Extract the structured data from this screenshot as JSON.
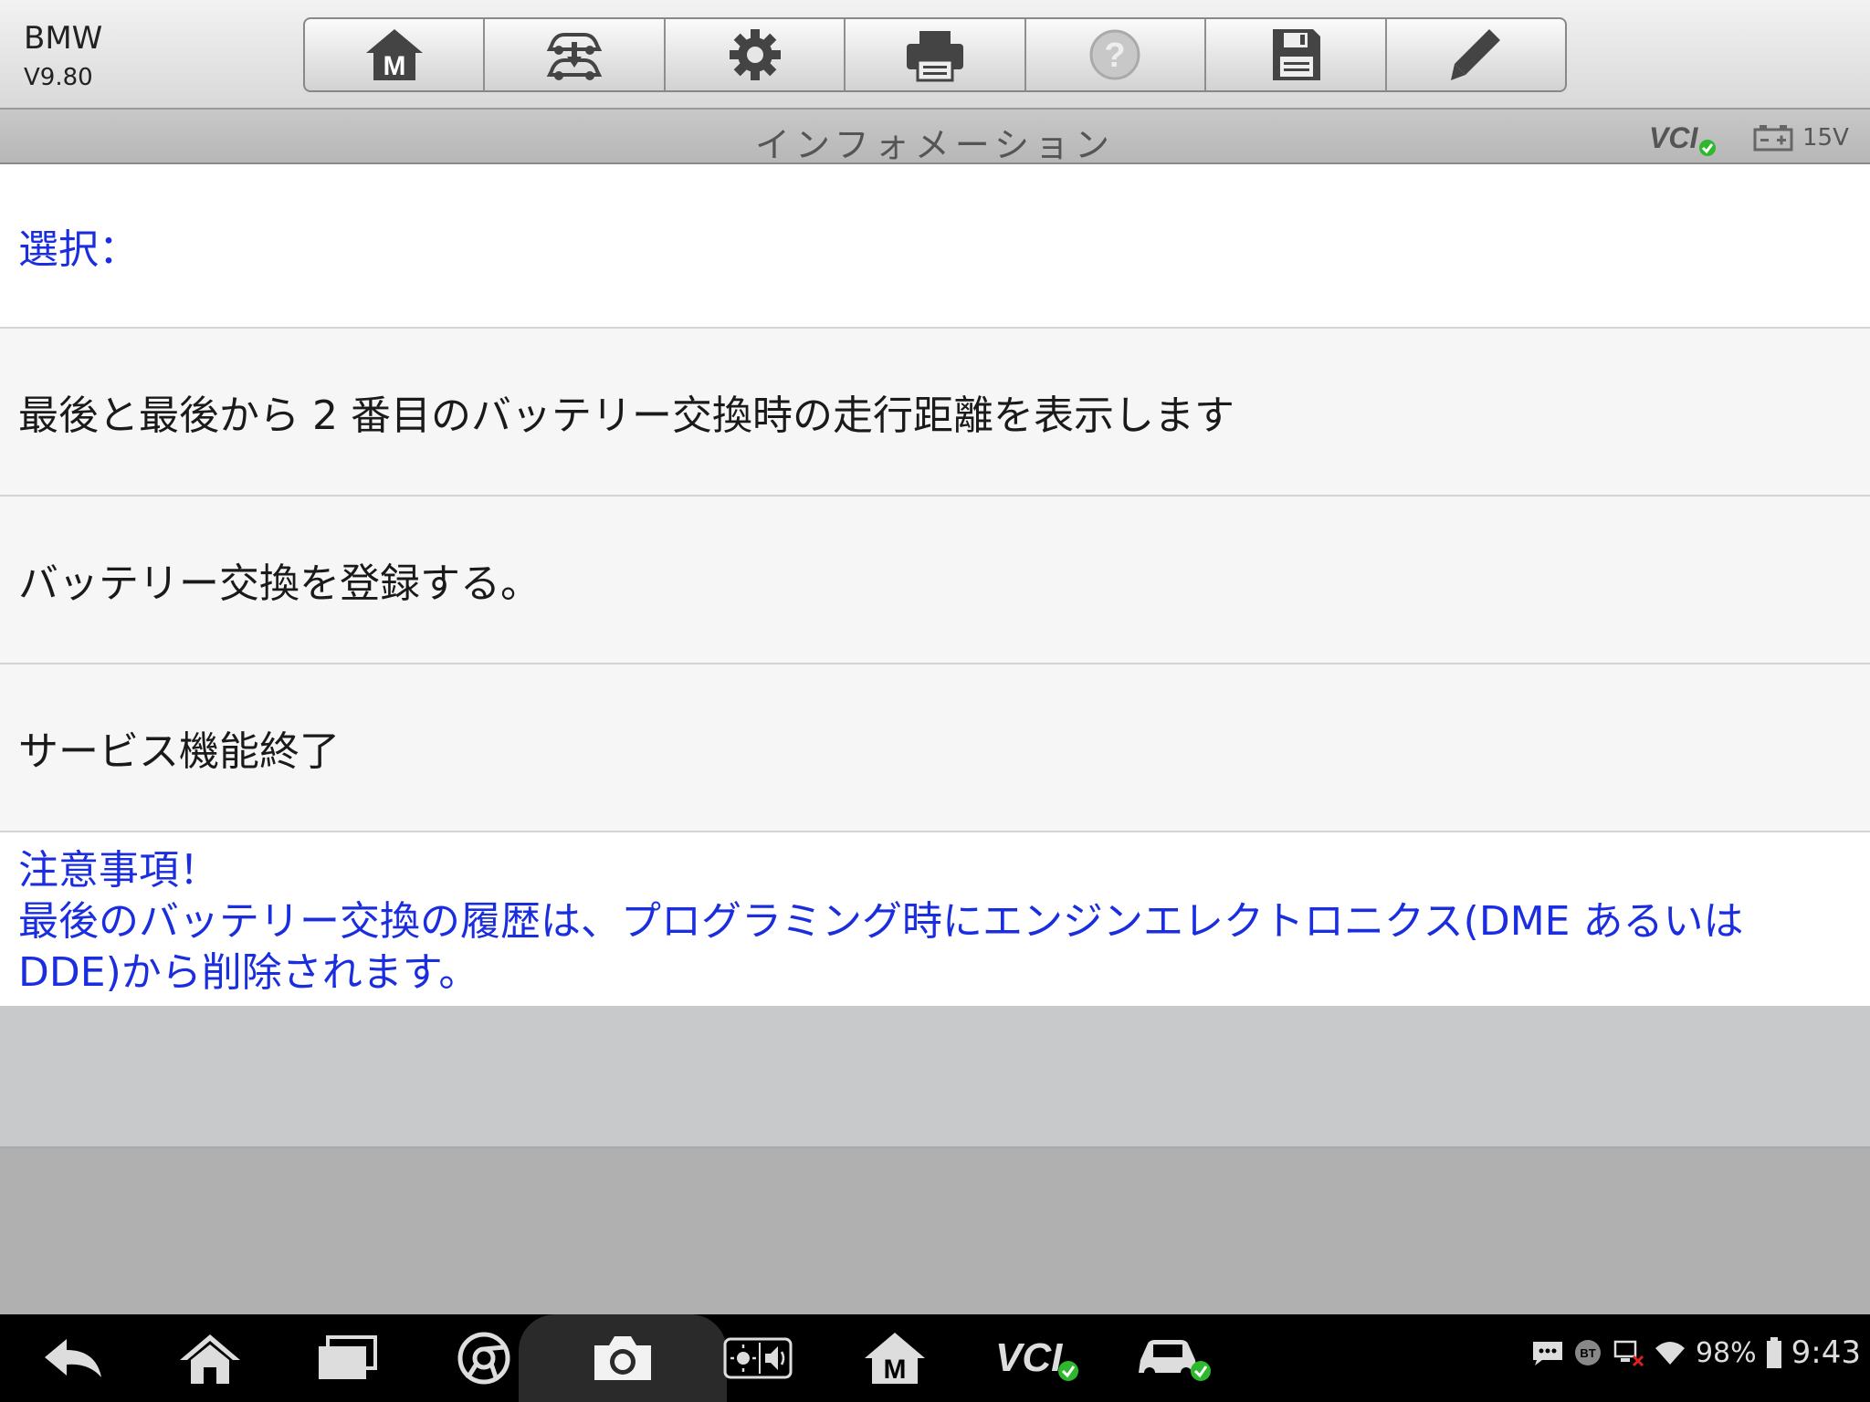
{
  "app": {
    "name": "BMW",
    "version": "V9.80"
  },
  "toolbar": {
    "buttons": [
      {
        "icon": "m-home-icon"
      },
      {
        "icon": "vehicle-swap-icon"
      },
      {
        "icon": "gear-icon"
      },
      {
        "icon": "printer-icon"
      },
      {
        "icon": "help-icon"
      },
      {
        "icon": "save-icon"
      },
      {
        "icon": "pencil-icon"
      }
    ]
  },
  "title_bar": {
    "title": "インフォメーション",
    "vci_label": "VCI",
    "battery_voltage": "15V"
  },
  "content": {
    "header": "選択：",
    "items": [
      "最後と最後から 2 番目のバッテリー交換時の走行距離を表示します",
      "バッテリー交換を登録する。",
      "サービス機能終了"
    ],
    "notice_title": "注意事項！",
    "notice_body_line1": "最後のバッテリー交換の履歴は、プログラミング時にエンジンエレクトロニクス(DME あるいは",
    "notice_body_line2": "DDE)から削除されます。"
  },
  "navbar": {
    "vci_label": "VCI",
    "battery_percent": "98%",
    "time": "9:43",
    "bt_label": "BT"
  },
  "colors": {
    "accent_blue": "#1a2ee0",
    "ok_green": "#2eb82e"
  }
}
